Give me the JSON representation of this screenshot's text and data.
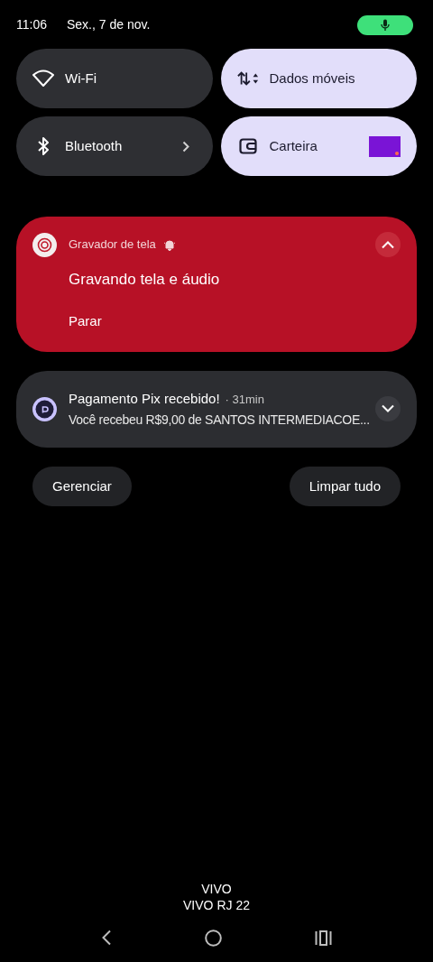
{
  "status_bar": {
    "time": "11:06",
    "date": "Sex., 7 de nov.",
    "mic_active": true
  },
  "tiles": [
    {
      "kind": "wifi",
      "label": "Wi-Fi",
      "on": false
    },
    {
      "kind": "data",
      "label": "Dados móveis",
      "on": true
    },
    {
      "kind": "bluetooth",
      "label": "Bluetooth",
      "on": false
    },
    {
      "kind": "wallet",
      "label": "Carteira",
      "on": true
    }
  ],
  "notifications": [
    {
      "kind": "recorder",
      "app": "Gravador de tela",
      "title": "Gravando tela e áudio",
      "action": "Parar",
      "expanded": true
    },
    {
      "kind": "pix",
      "title": "Pagamento Pix recebido!",
      "time": "· 31min",
      "text": "Você recebeu R$9,00 de SANTOS INTERMEDIACOE...",
      "expanded": false
    }
  ],
  "buttons": [
    "Gerenciar",
    "Limpar tudo"
  ],
  "carrier": [
    "VIVO",
    "VIVO RJ 22"
  ]
}
